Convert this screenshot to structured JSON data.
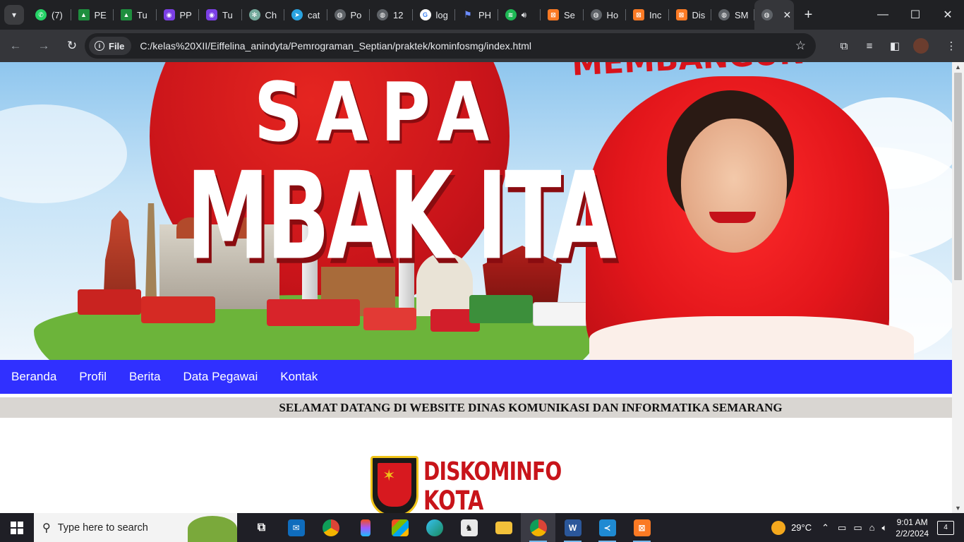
{
  "browser": {
    "tabs": [
      {
        "label": "(7)",
        "color": "#25d366",
        "icon": "whatsapp-icon"
      },
      {
        "label": "PE",
        "color": "#1e8e3e",
        "icon": "google-drive-icon"
      },
      {
        "label": "Tu",
        "color": "#1e8e3e",
        "icon": "google-drive-icon"
      },
      {
        "label": "PP",
        "color": "#7b3fe4",
        "icon": "owl-icon"
      },
      {
        "label": "Tu",
        "color": "#7b3fe4",
        "icon": "owl-icon"
      },
      {
        "label": "Ch",
        "color": "#74aa9c",
        "icon": "chatgpt-icon"
      },
      {
        "label": "cat",
        "color": "#2aa3e0",
        "icon": "telegram-icon"
      },
      {
        "label": "Po",
        "color": "#5f6368",
        "icon": "globe-icon"
      },
      {
        "label": "12",
        "color": "#5f6368",
        "icon": "globe-icon"
      },
      {
        "label": "log",
        "color": "#4285f4",
        "icon": "google-icon"
      },
      {
        "label": "PH",
        "color": "#3b6ce8",
        "icon": "flag-icon"
      },
      {
        "label": "",
        "color": "#1db954",
        "icon": "spotify-icon"
      },
      {
        "label": "Se",
        "color": "#fb7a24",
        "icon": "xampp-icon"
      },
      {
        "label": "Ho",
        "color": "#5f6368",
        "icon": "globe-icon"
      },
      {
        "label": "Inc",
        "color": "#fb7a24",
        "icon": "xampp-icon"
      },
      {
        "label": "Dis",
        "color": "#fb7a24",
        "icon": "xampp-icon"
      },
      {
        "label": "SM",
        "color": "#5f6368",
        "icon": "globe-icon"
      }
    ],
    "site_chip": "File",
    "url": "C:/kelas%20XII/Eiffelina_anindyta/Pemrograman_Septian/praktek/kominfosmg/index.html"
  },
  "banner": {
    "headline_top": "SAPA",
    "headline_main": "MBAK ITA",
    "slogan_fragment": "MEMBANGUN",
    "colors": {
      "red": "#d7191f",
      "sky": "#8fc6ee",
      "grass": "#6cb43a"
    }
  },
  "nav": {
    "items": [
      {
        "label": "Beranda"
      },
      {
        "label": "Profil"
      },
      {
        "label": "Berita"
      },
      {
        "label": "Data Pegawai"
      },
      {
        "label": "Kontak"
      }
    ],
    "color": "#3030ff"
  },
  "welcome": {
    "text": "SELAMAT DATANG DI WEBSITE DINAS KOMUNIKASI DAN INFORMATIKA SEMARANG"
  },
  "logo": {
    "line1": "DISKOMINFO",
    "line2": "KOTA SEMARANG"
  },
  "taskbar": {
    "search_placeholder": "Type here to search",
    "weather": "29°C",
    "time": "9:01 AM",
    "date": "2/2/2024",
    "notifications": "4"
  }
}
